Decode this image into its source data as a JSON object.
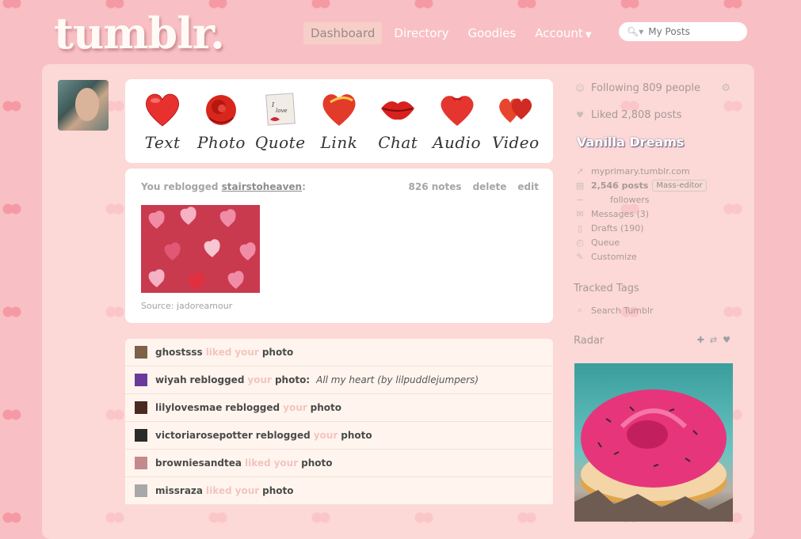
{
  "brand": {
    "logo": "tumblr."
  },
  "nav": {
    "items": [
      {
        "label": "Dashboard",
        "active": true
      },
      {
        "label": "Directory"
      },
      {
        "label": "Goodies"
      },
      {
        "label": "Account"
      }
    ],
    "search_placeholder": "My Posts"
  },
  "post_types": [
    "Text",
    "Photo",
    "Quote",
    "Link",
    "Chat",
    "Audio",
    "Video"
  ],
  "post": {
    "prefix": "You reblogged",
    "user": "stairstoheaven",
    "suffix": ":",
    "notes": "826 notes",
    "delete": "delete",
    "edit": "edit",
    "source": "Source: jadoreamour"
  },
  "activity": [
    {
      "user": "ghostsss",
      "action": "liked",
      "your": "your",
      "object": "photo",
      "quote": ""
    },
    {
      "user": "wiyah",
      "action": "reblogged",
      "your": "your",
      "object": "photo:",
      "quote": "All my heart (by lilpuddlejumpers)"
    },
    {
      "user": "lilylovesmae",
      "action": "reblogged",
      "your": "your",
      "object": "photo",
      "quote": ""
    },
    {
      "user": "victoriarosepotter",
      "action": "reblogged",
      "your": "your",
      "object": "photo",
      "quote": ""
    },
    {
      "user": "browniesandtea",
      "action": "liked",
      "your": "your",
      "object": "photo",
      "quote": ""
    },
    {
      "user": "missraza",
      "action": "liked",
      "your": "your",
      "object": "photo",
      "quote": ""
    }
  ],
  "sidebar": {
    "following": "Following 809 people",
    "liked": "Liked 2,808 posts",
    "blog_title": "Vanilla Dreams",
    "links": {
      "url": "myprimary.tumblr.com",
      "posts": "2,546 posts",
      "mass_editor": "Mass-editor",
      "followers": "followers",
      "messages": "Messages (3)",
      "drafts": "Drafts (190)",
      "queue": "Queue",
      "customize": "Customize"
    },
    "tracked_tags": "Tracked Tags",
    "search_tumblr": "Search Tumblr",
    "radar": "Radar"
  },
  "colors": {
    "background": "#f8c0c4",
    "accent_red": "#e8312f",
    "panel": "#ffffff"
  }
}
